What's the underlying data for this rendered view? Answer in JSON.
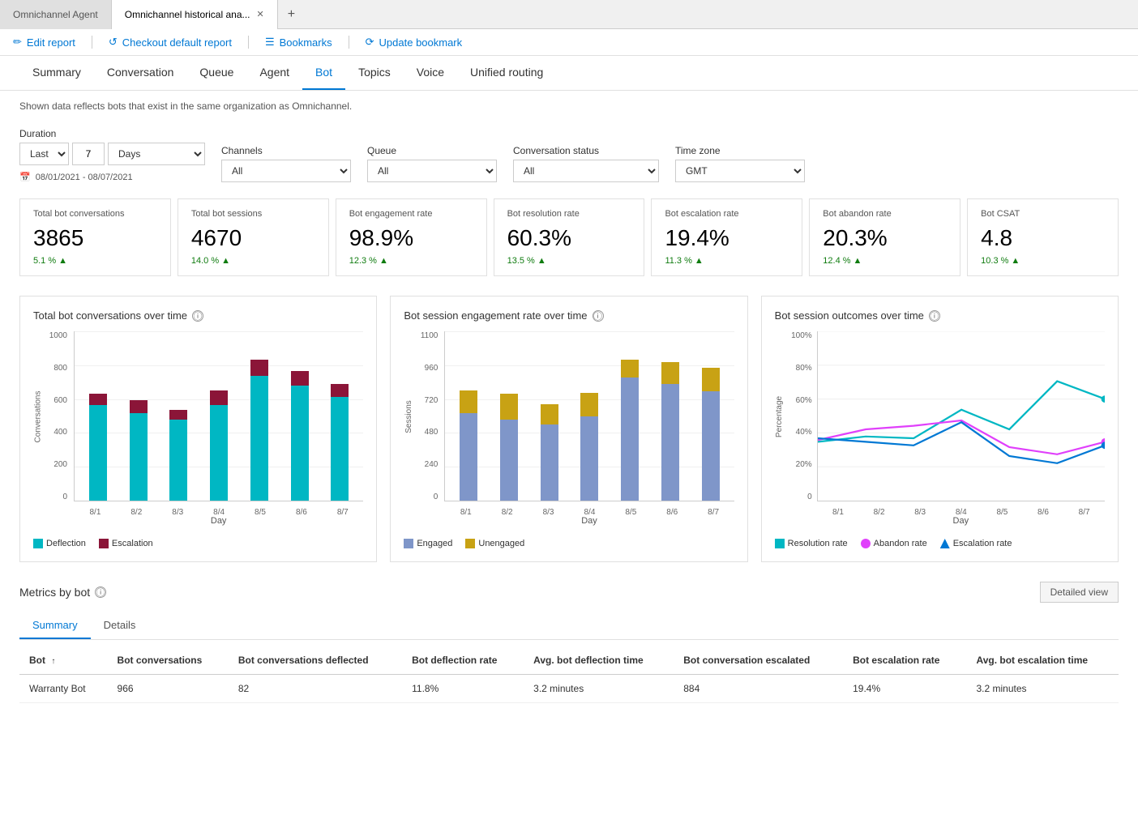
{
  "browser": {
    "tabs": [
      {
        "label": "Omnichannel Agent",
        "active": false,
        "closeable": false
      },
      {
        "label": "Omnichannel historical ana...",
        "active": true,
        "closeable": true
      }
    ],
    "add_tab_label": "+"
  },
  "toolbar": {
    "edit_report": "Edit report",
    "checkout_report": "Checkout default report",
    "bookmarks": "Bookmarks",
    "update_bookmark": "Update bookmark"
  },
  "nav": {
    "tabs": [
      "Summary",
      "Conversation",
      "Queue",
      "Agent",
      "Bot",
      "Topics",
      "Voice",
      "Unified routing"
    ],
    "active": "Bot"
  },
  "info_text": "Shown data reflects bots that exist in the same organization as Omnichannel.",
  "filters": {
    "duration_label": "Duration",
    "duration_preset": "Last",
    "duration_value": "7",
    "duration_unit": "Days",
    "channels_label": "Channels",
    "channels_value": "All",
    "queue_label": "Queue",
    "queue_value": "All",
    "conversation_status_label": "Conversation status",
    "conversation_status_value": "All",
    "timezone_label": "Time zone",
    "timezone_value": "GMT",
    "date_range": "08/01/2021 - 08/07/2021"
  },
  "kpi_cards": [
    {
      "title": "Total bot conversations",
      "value": "3865",
      "change": "5.1 %",
      "trend": "up"
    },
    {
      "title": "Total bot sessions",
      "value": "4670",
      "change": "14.0 %",
      "trend": "up"
    },
    {
      "title": "Bot engagement rate",
      "value": "98.9%",
      "change": "12.3 %",
      "trend": "up"
    },
    {
      "title": "Bot resolution rate",
      "value": "60.3%",
      "change": "13.5 %",
      "trend": "up"
    },
    {
      "title": "Bot escalation rate",
      "value": "19.4%",
      "change": "11.3 %",
      "trend": "up"
    },
    {
      "title": "Bot abandon rate",
      "value": "20.3%",
      "change": "12.4 %",
      "trend": "up"
    },
    {
      "title": "Bot CSAT",
      "value": "4.8",
      "change": "10.3 %",
      "trend": "up"
    }
  ],
  "chart1": {
    "title": "Total bot conversations over time",
    "y_labels": [
      "1000",
      "800",
      "600",
      "400",
      "200",
      "0"
    ],
    "x_labels": [
      "8/1",
      "8/2",
      "8/3",
      "8/4",
      "8/5",
      "8/6",
      "8/7"
    ],
    "x_title": "Day",
    "y_title": "Conversations",
    "legend": [
      {
        "label": "Deflection",
        "color": "#00b7c3"
      },
      {
        "label": "Escalation",
        "color": "#8b1538"
      }
    ],
    "bars": [
      {
        "deflection": 60,
        "escalation": 7
      },
      {
        "deflection": 55,
        "escalation": 8
      },
      {
        "deflection": 50,
        "escalation": 6
      },
      {
        "deflection": 60,
        "escalation": 9
      },
      {
        "deflection": 78,
        "escalation": 10
      },
      {
        "deflection": 72,
        "escalation": 9
      },
      {
        "deflection": 65,
        "escalation": 8
      }
    ]
  },
  "chart2": {
    "title": "Bot session engagement rate over time",
    "y_labels": [
      "1100",
      "960",
      "720",
      "480",
      "240",
      "0"
    ],
    "x_labels": [
      "8/1",
      "8/2",
      "8/3",
      "8/4",
      "8/5",
      "8/6",
      "8/7"
    ],
    "x_title": "Day",
    "y_title": "Sessions",
    "legend": [
      {
        "label": "Engaged",
        "color": "#7f96c9"
      },
      {
        "label": "Unengaged",
        "color": "#c8a214"
      }
    ],
    "bars": [
      {
        "engaged": 60,
        "unengaged": 15
      },
      {
        "engaged": 55,
        "unengaged": 18
      },
      {
        "engaged": 52,
        "unengaged": 14
      },
      {
        "engaged": 58,
        "unengaged": 16
      },
      {
        "engaged": 85,
        "unengaged": 12
      },
      {
        "engaged": 80,
        "unengaged": 15
      },
      {
        "engaged": 75,
        "unengaged": 16
      }
    ]
  },
  "chart3": {
    "title": "Bot session outcomes over time",
    "y_labels": [
      "100%",
      "80%",
      "60%",
      "40%",
      "20%",
      "0"
    ],
    "x_labels": [
      "8/1",
      "8/2",
      "8/3",
      "8/4",
      "8/5",
      "8/6",
      "8/7"
    ],
    "x_title": "Day",
    "y_title": "Percentage",
    "legend": [
      {
        "label": "Resolution rate",
        "color": "#00b7c3"
      },
      {
        "label": "Abandon rate",
        "color": "#e040fb"
      },
      {
        "label": "Escalation rate",
        "color": "#0078d4"
      }
    ]
  },
  "metrics_section": {
    "title": "Metrics by bot",
    "detailed_view_label": "Detailed view",
    "tabs": [
      "Summary",
      "Details"
    ],
    "active_tab": "Summary",
    "table_headers": [
      {
        "label": "Bot",
        "sortable": true
      },
      {
        "label": "Bot conversations",
        "sortable": false
      },
      {
        "label": "Bot conversations deflected",
        "sortable": false
      },
      {
        "label": "Bot deflection rate",
        "sortable": false
      },
      {
        "label": "Avg. bot deflection time",
        "sortable": false
      },
      {
        "label": "Bot conversation escalated",
        "sortable": false
      },
      {
        "label": "Bot escalation rate",
        "sortable": false
      },
      {
        "label": "Avg. bot escalation time",
        "sortable": false
      }
    ],
    "table_rows": [
      {
        "bot": "Warranty Bot",
        "conversations": "966",
        "deflected": "82",
        "deflection_rate": "11.8%",
        "avg_deflection_time": "3.2 minutes",
        "escalated": "884",
        "escalation_rate": "19.4%",
        "avg_escalation_time": "3.2 minutes"
      }
    ]
  }
}
